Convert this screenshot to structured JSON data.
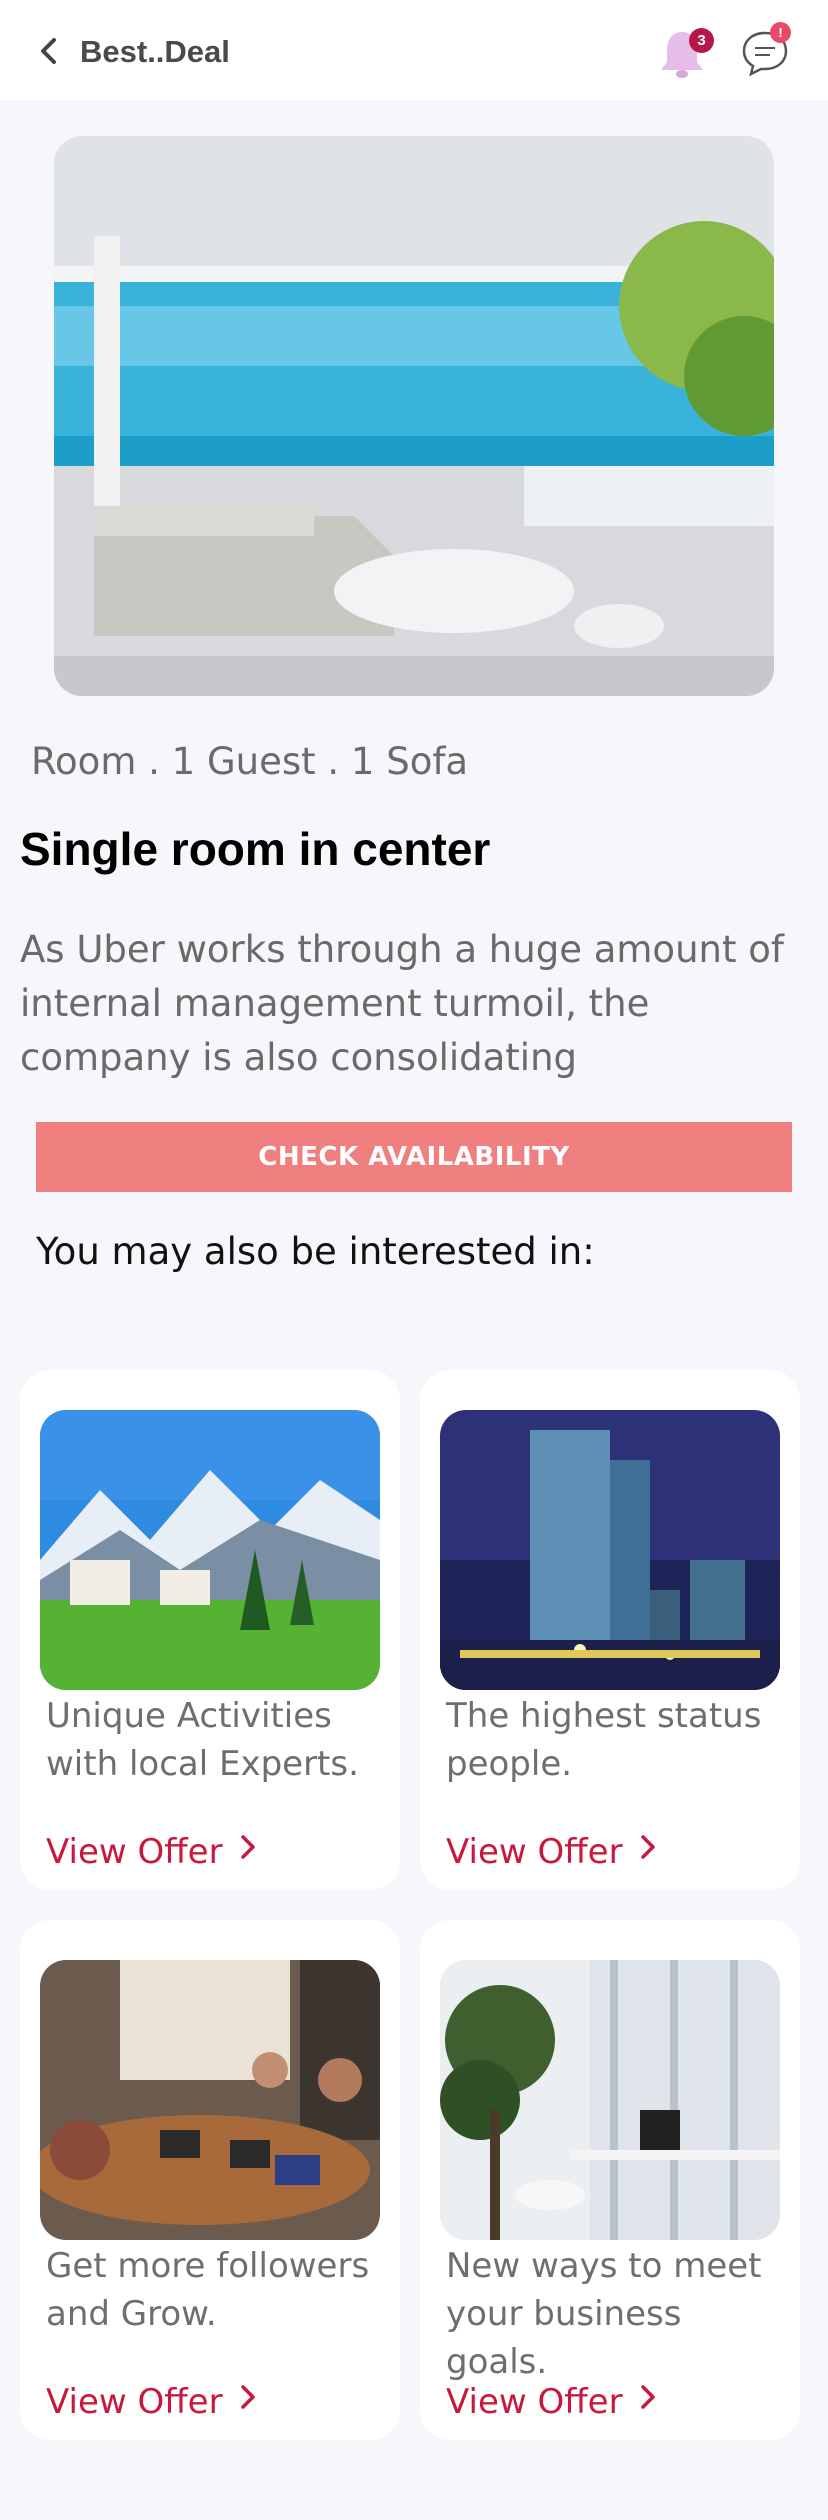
{
  "header": {
    "title": "Best..Deal",
    "back_icon": "chevron-left-icon",
    "notification_icon": "bell-icon",
    "notification_count": "3",
    "chat_icon": "chat-icon",
    "chat_count": "!"
  },
  "listing": {
    "meta": "Room . 1 Guest . 1 Sofa",
    "title": "Single room in center",
    "description": "As Uber works through a huge amount of internal management turmoil, the company  is also consolidating",
    "cta_label": "CHECK AVAILABILITY"
  },
  "recommendations": {
    "heading": "You may also be interested in:",
    "items": [
      {
        "text": "Unique Activities with local Experts.",
        "link_label": "View Offer"
      },
      {
        "text": "The highest status people.",
        "link_label": "View Offer"
      },
      {
        "text": "Get more followers and Grow.",
        "link_label": "View Offer"
      },
      {
        "text": "New ways to meet your business goals.",
        "link_label": "View Offer"
      }
    ]
  },
  "colors": {
    "accent": "#c8193c",
    "cta": "#f07f7f",
    "badge": "#b5174a",
    "background": "#f6f6fb"
  }
}
